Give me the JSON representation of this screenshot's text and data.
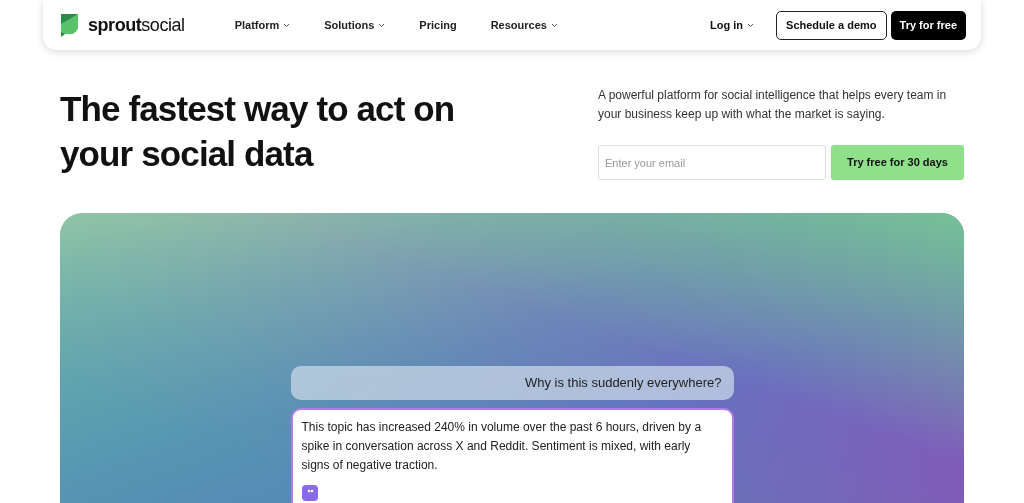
{
  "nav": {
    "logo": "**sprout**social",
    "items": [
      {
        "label": "Platform",
        "dropdown": true
      },
      {
        "label": "Solutions",
        "dropdown": true
      },
      {
        "label": "Pricing",
        "dropdown": false
      },
      {
        "label": "Resources",
        "dropdown": true
      }
    ],
    "login": {
      "label": "Log in",
      "dropdown": true
    },
    "demo_button": "Schedule a demo",
    "try_button": "Try for free"
  },
  "hero": {
    "headline": "The fastest way to act on your social data",
    "description": "A powerful platform for social intelligence that helps every team in your business keep up with what the market is saying.",
    "email": {
      "placeholder": "Enter your email"
    },
    "cta": "Try free for 30 days"
  },
  "chat": {
    "question": "Why is this suddenly everywhere?",
    "answer": "This topic has increased 240% in volume over the past 6 hours, driven by a spike in conversation across X and Reddit. Sentiment is mixed, with early signs of negative traction."
  }
}
